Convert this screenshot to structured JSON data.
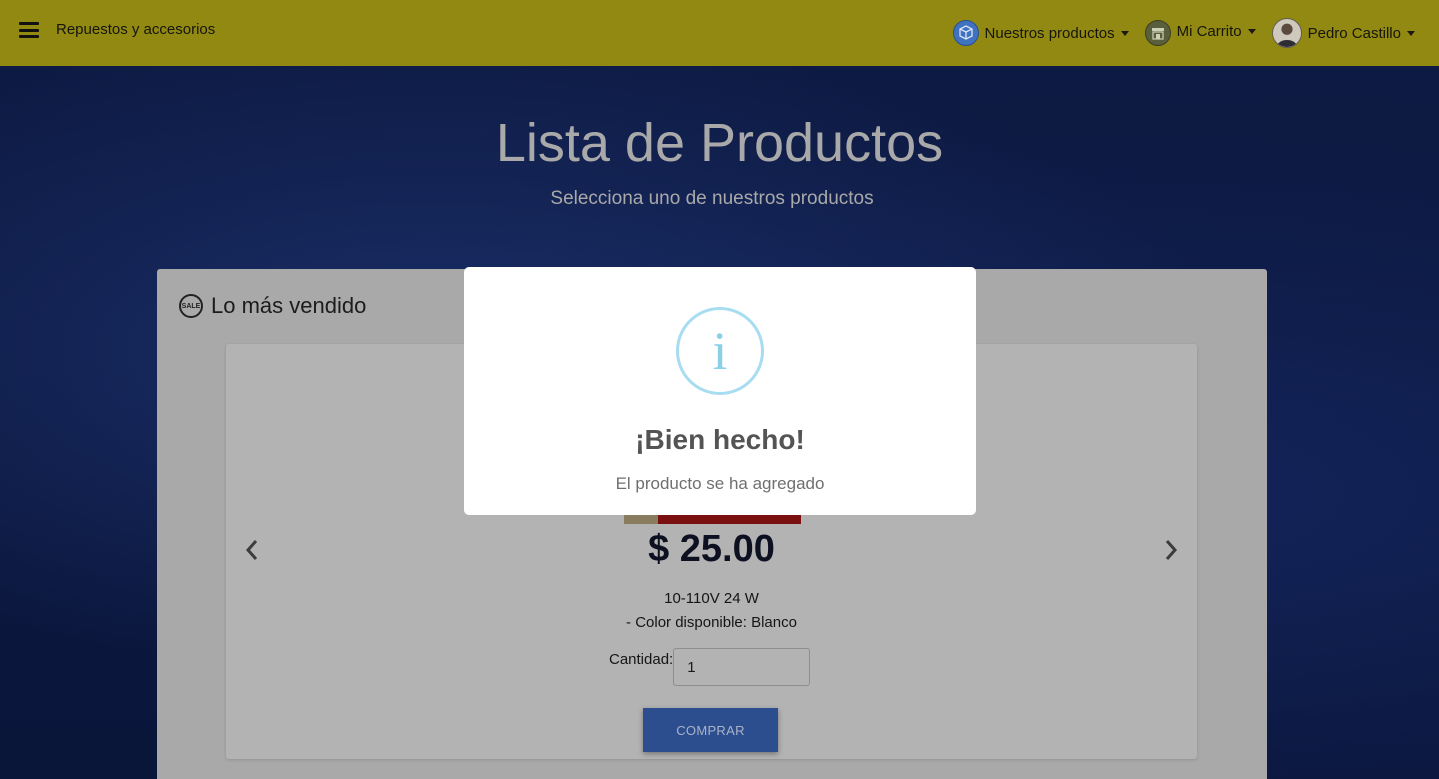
{
  "navbar": {
    "brand": "Repuestos y accesorios",
    "products_label": "Nuestros productos",
    "cart_label": "Mi Carrito",
    "user_name": "Pedro Castillo",
    "background_color": "#928913"
  },
  "hero": {
    "title": "Lista de Productos",
    "subtitle": "Selecciona uno de nuestros productos"
  },
  "best_sellers": {
    "heading": "Lo más vendido",
    "sale_icon_text": "SALE",
    "product": {
      "price": "$ 25.00",
      "spec_line": "10-110V 24 W",
      "color_line": "- Color disponible: Blanco",
      "quantity_label": "Cantidad:",
      "quantity_value": "1",
      "buy_label": "COMPRAR"
    }
  },
  "modal": {
    "icon": "info-icon",
    "title": "¡Bien hecho!",
    "message": "El producto se ha agregado"
  }
}
